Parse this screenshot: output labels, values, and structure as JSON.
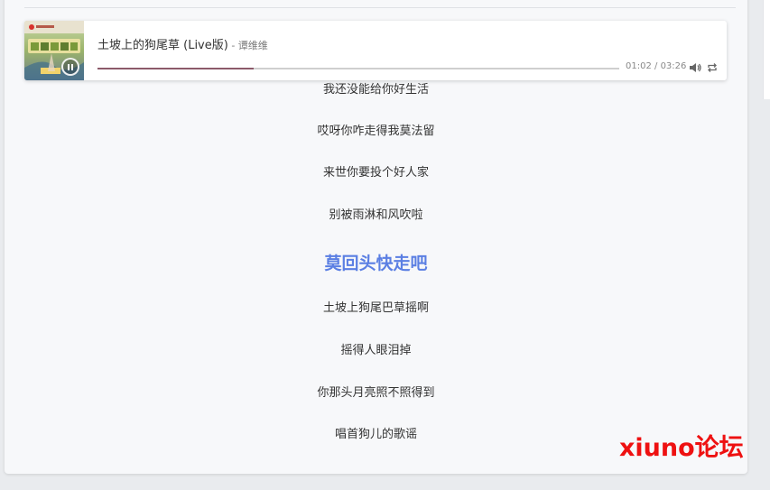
{
  "player": {
    "song_title": "土坡上的狗尾草 (Live版)",
    "artist_prefix": " - ",
    "artist": "谭维维",
    "current_time": "01:02",
    "time_separator": " / ",
    "total_time": "03:26",
    "progress_fraction": 0.3,
    "state": "playing",
    "cover_icon": "album-cover",
    "pause_icon": "pause-icon",
    "volume_icon": "volume-icon",
    "loop_icon": "loop-icon",
    "accent_color": "#8c5a6a"
  },
  "lyrics": {
    "active_index": 4,
    "active_color": "#5b7fe3",
    "lines": [
      "我还没能给你好生活",
      "哎呀你咋走得我莫法留",
      "来世你要投个好人家",
      "别被雨淋和风吹啦",
      "莫回头快走吧",
      "土坡上狗尾巴草摇啊",
      "摇得人眼泪掉",
      "你那头月亮照不照得到",
      "唱首狗儿的歌谣"
    ]
  },
  "watermark": {
    "text": "xiuno论坛",
    "color": "#ee1111"
  }
}
